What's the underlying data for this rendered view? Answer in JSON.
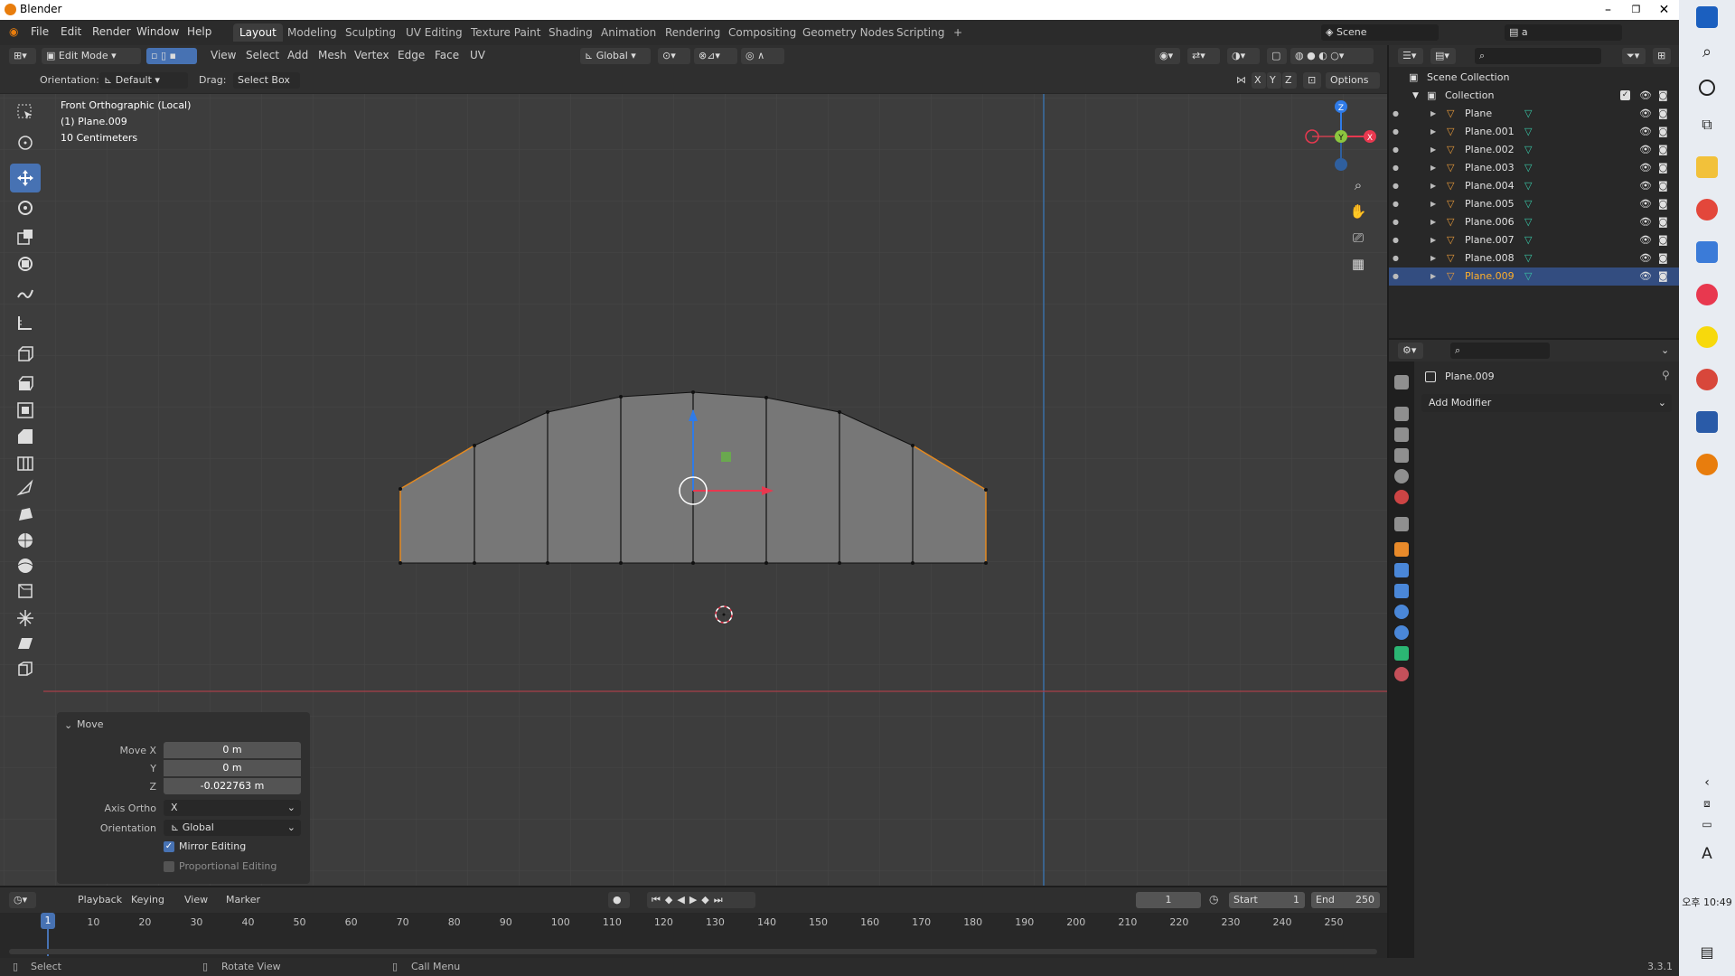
{
  "window": {
    "title": "Blender"
  },
  "menu": [
    "File",
    "Edit",
    "Render",
    "Window",
    "Help"
  ],
  "workspaces": [
    "Layout",
    "Modeling",
    "Sculpting",
    "UV Editing",
    "Texture Paint",
    "Shading",
    "Animation",
    "Rendering",
    "Compositing",
    "Geometry Nodes",
    "Scripting",
    "+"
  ],
  "scene": {
    "label": "Scene",
    "viewlayer": "a"
  },
  "viewport_header": {
    "mode": "Edit Mode",
    "menus": [
      "View",
      "Select",
      "Add",
      "Mesh",
      "Vertex",
      "Edge",
      "Face",
      "UV"
    ],
    "transform_orientation": "Global",
    "orientation_label": "Orientation:",
    "orientation_value": "Default",
    "drag_label": "Drag:",
    "drag_value": "Select Box",
    "axes": [
      "X",
      "Y",
      "Z"
    ],
    "options": "Options"
  },
  "viewport_overlay": {
    "view_name": "Front Orthographic (Local)",
    "object": "(1) Plane.009",
    "scale": "10 Centimeters"
  },
  "gizmo": {
    "z": "Z",
    "y": "Y",
    "x": "X"
  },
  "operator_panel": {
    "title": "Move",
    "move_x_label": "Move X",
    "move_x": "0 m",
    "y_label": "Y",
    "y": "0 m",
    "z_label": "Z",
    "z": "-0.022763 m",
    "axis_ortho_label": "Axis Ortho",
    "axis_ortho": "X",
    "orientation_label": "Orientation",
    "orientation": "Global",
    "mirror_editing": "Mirror Editing",
    "proportional_editing": "Proportional Editing"
  },
  "outliner": {
    "scene_collection": "Scene Collection",
    "collection": "Collection",
    "objects": [
      "Plane",
      "Plane.001",
      "Plane.002",
      "Plane.003",
      "Plane.004",
      "Plane.005",
      "Plane.006",
      "Plane.007",
      "Plane.008",
      "Plane.009"
    ],
    "selected": "Plane.009"
  },
  "properties": {
    "object_name": "Plane.009",
    "add_modifier": "Add Modifier"
  },
  "timeline": {
    "menus": [
      "Playback",
      "Keying",
      "View",
      "Marker"
    ],
    "current_frame": "1",
    "start_label": "Start",
    "start": "1",
    "end_label": "End",
    "end": "250",
    "ticks": [
      "10",
      "20",
      "30",
      "40",
      "50",
      "60",
      "70",
      "80",
      "90",
      "100",
      "110",
      "120",
      "130",
      "140",
      "150",
      "160",
      "170",
      "180",
      "190",
      "200",
      "210",
      "220",
      "230",
      "240",
      "250"
    ],
    "playhead": "1"
  },
  "status": {
    "select": "Select",
    "rotate": "Rotate View",
    "call_menu": "Call Menu",
    "version": "3.3.1"
  },
  "taskbar": {
    "ime": "A",
    "clock": "오후 10:49"
  }
}
